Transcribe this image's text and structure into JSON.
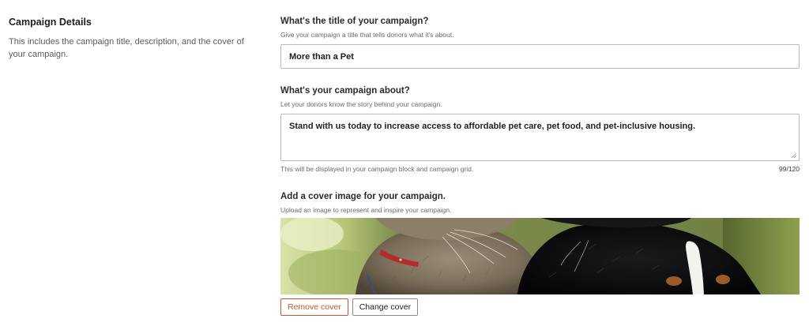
{
  "section": {
    "title": "Campaign Details",
    "description": "This includes the campaign title, description, and the cover of your campaign."
  },
  "title_field": {
    "label": "What's the title of your campaign?",
    "help": "Give your campaign a title that tells donors what it's about.",
    "value": "More than a Pet"
  },
  "about_field": {
    "label": "What's your campaign about?",
    "help": "Let your donors know the story behind your campaign.",
    "value": "Stand with us today to increase access to affordable pet care, pet food, and pet-inclusive housing.",
    "footer_note": "This will be displayed in your campaign block and campaign grid.",
    "counter": "99/120"
  },
  "cover_field": {
    "label": "Add a cover image for your campaign.",
    "help": "Upload an image to represent and inspire your campaign.",
    "image_subject": "cat-and-dog-photo"
  },
  "buttons": {
    "remove_label": "Remove cover",
    "change_label": "Change cover"
  },
  "colors": {
    "remove_accent": "#c9552f",
    "border": "#b8b8b8",
    "text": "#1e1e1e",
    "muted": "#6b6b6b"
  }
}
